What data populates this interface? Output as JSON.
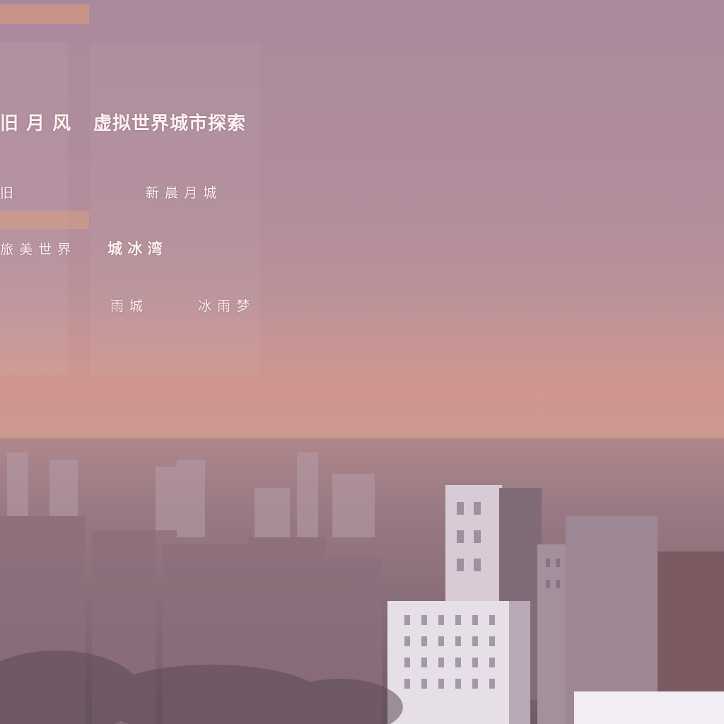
{
  "menu": {
    "title_left": "旧 月 风",
    "title_main": "虚拟世界城市探索",
    "row1_left": "旧",
    "row1_right": "新 晨 月 城",
    "row2_left": "旅 美 世 界",
    "row2_right": "城 冰 湾",
    "row3_left": "雨 城",
    "row3_right": "冰 雨 梦"
  },
  "colors": {
    "text": "#fbf3f1",
    "sky_top": "#a98a9c",
    "horizon_glow": "#c99a92"
  }
}
